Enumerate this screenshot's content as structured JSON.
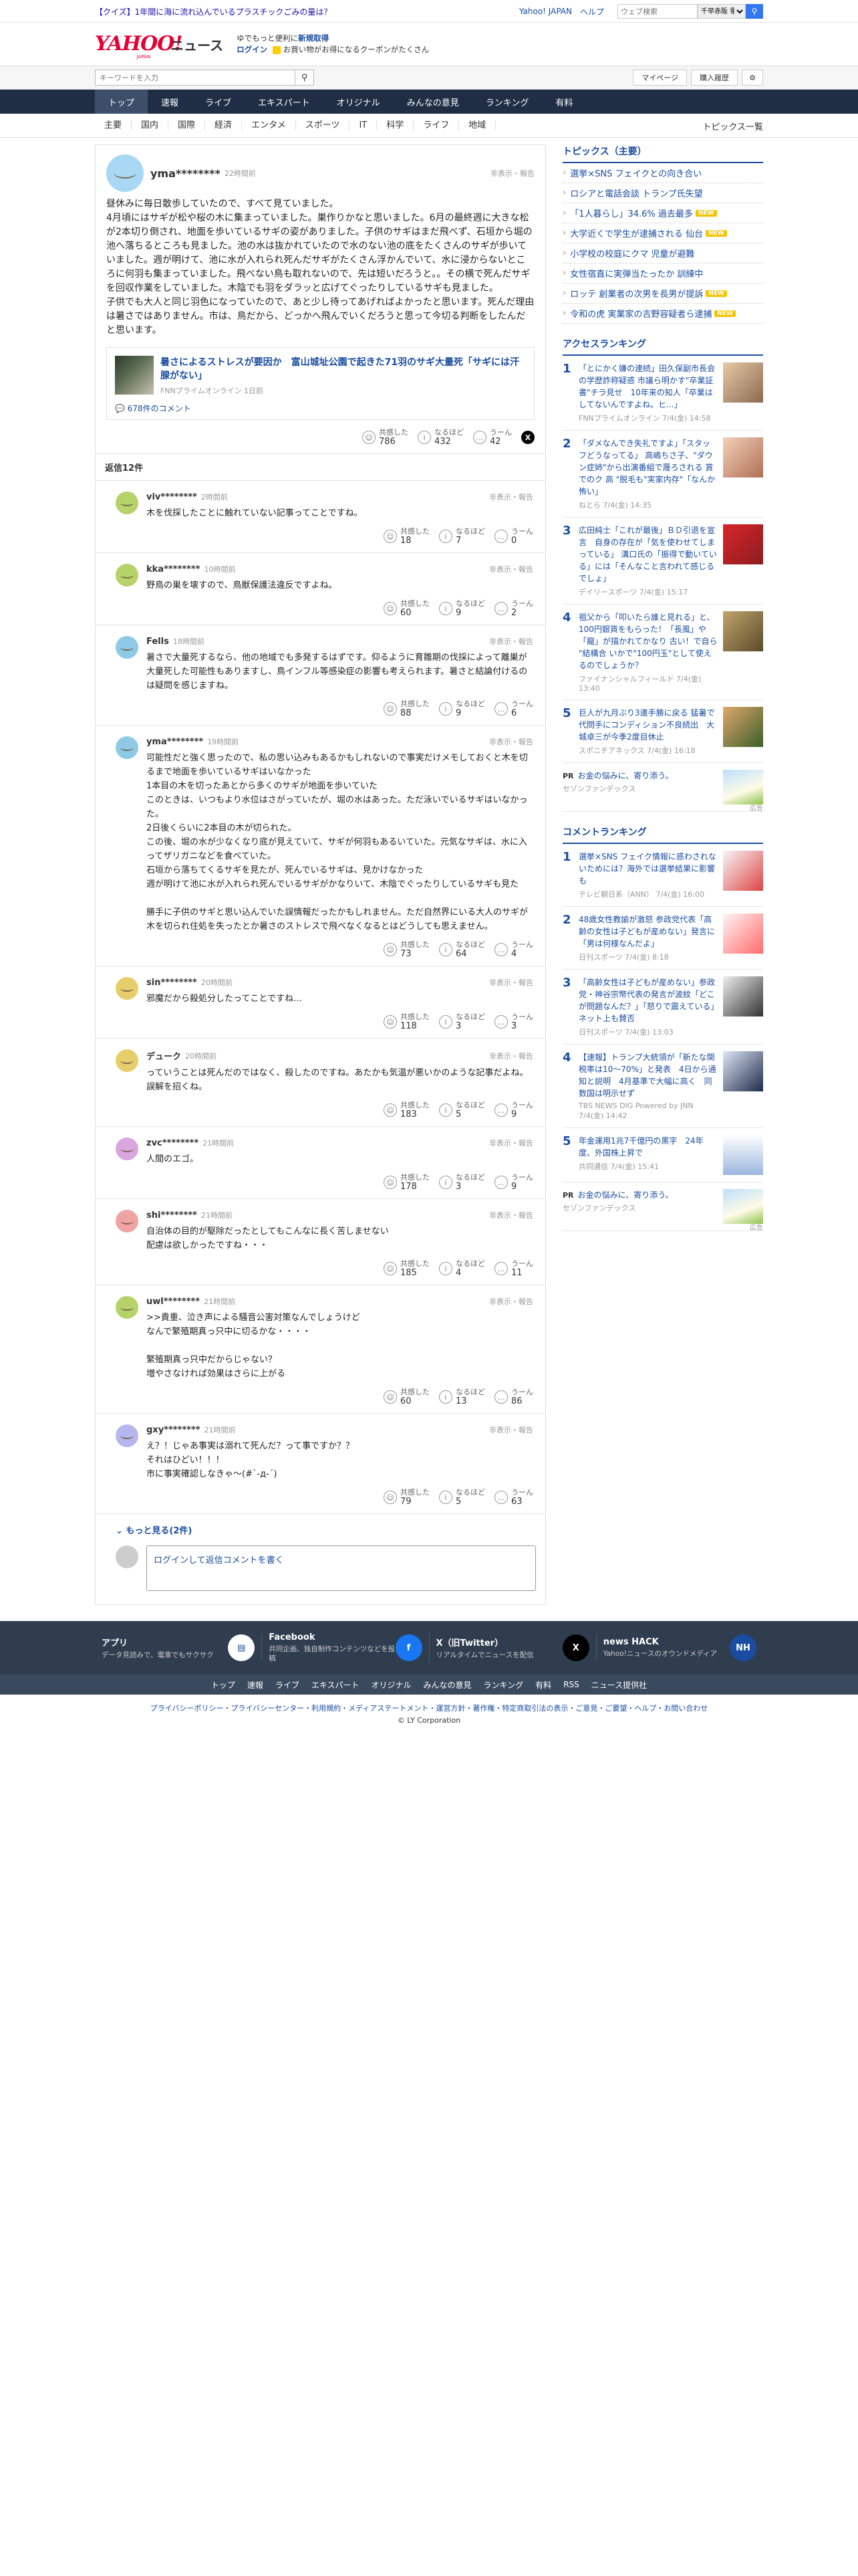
{
  "topbar": {
    "quiz": "【クイズ】1年間に海に流れ込んでいるプラスチックごみの量は？",
    "links": [
      "Yahoo! JAPAN",
      "ヘルプ"
    ],
    "search_placeholder": "ウェブ検索",
    "search_select": "千早赤阪 電も拳..."
  },
  "header": {
    "logo": "YAHOO!",
    "logo_sub": "JAPAN",
    "service": "ニュース",
    "promo_line1_a": "ゆでもっと便利に",
    "promo_line1_b": "新規取得",
    "login": "ログイン",
    "promo_line2": "お買い物がお得になるクーポンがたくさん"
  },
  "search": {
    "placeholder": "キーワードを入力",
    "mypage": "マイページ",
    "history": "購入履歴"
  },
  "gnav": [
    "トップ",
    "速報",
    "ライブ",
    "エキスパート",
    "オリジナル",
    "みんなの意見",
    "ランキング",
    "有料"
  ],
  "subnav": [
    "主要",
    "国内",
    "国際",
    "経済",
    "エンタメ",
    "スポーツ",
    "IT",
    "科学",
    "ライフ",
    "地域"
  ],
  "subnav_all": "トピックス一覧",
  "post": {
    "user": "yma********",
    "time": "22時間前",
    "report": "非表示・報告",
    "text": "昼休みに毎日散歩していたので、すべて見ていました。\n4月頃にはサギが松や桜の木に集まっていました。巣作りかなと思いました。6月の最終週に大きな松が2本切り倒され、地面を歩いているサギの姿がありました。子供のサギはまだ飛べず、石垣から堀の池へ落ちるところも見ました。池の水は抜かれていたので水のない池の底をたくさんのサギが歩いていました。週が明けて、池に水が入れられ死んだサギがたくさん浮かんでいて、水に浸からないところに何羽も集まっていました。飛べない鳥も取れないので、先は短いだろうと。。その横で死んだサギを回収作業をしていました。木陰でも羽をダラッと広げてぐったりしているサギも見ました。\n子供でも大人と同じ羽色になっていたので、あと少し待ってあげればよかったと思います。死んだ理由は暑さではありません。市は、鳥だから、どっかへ飛んでいくだろうと思って今切る判断をしたんだと思います。",
    "article_title": "暑さによるストレスが要因か　富山城址公園で起きた71羽のサギ大量死「サギには汗腺がない」",
    "article_source": "FNNプライムオンライン 1日前",
    "comments_count": "678件のコメント",
    "reactions": {
      "kyokan": "786",
      "naruhodo": "432",
      "uun": "42"
    }
  },
  "reaction_labels": {
    "kyokan": "共感した",
    "naruhodo": "なるほど",
    "uun": "うーん"
  },
  "replies_count_label": "返信12件",
  "replies": [
    {
      "user": "viv********",
      "time": "2時間前",
      "text": "木を伐採したことに触れていない記事ってことですね。",
      "kyokan": "18",
      "naruhodo": "7",
      "uun": "0",
      "color": "#b6d36a"
    },
    {
      "user": "kka********",
      "time": "10時間前",
      "text": "野鳥の巣を壊すので、鳥獣保護法違反ですよね。",
      "kyokan": "60",
      "naruhodo": "9",
      "uun": "2",
      "color": "#b6d36a"
    },
    {
      "user": "Fells",
      "time": "18時間前",
      "text": "暑さで大量死するなら、他の地域でも多発するはずです。仰るように育雛期の伐採によって離巣が大量死した可能性もありますし、鳥インフル等感染症の影響も考えられます。暑さと結論付けるのは疑問を感じますね。",
      "kyokan": "88",
      "naruhodo": "9",
      "uun": "6",
      "color": "#8ecae6"
    },
    {
      "user": "yma********",
      "time": "19時間前",
      "text": "可能性だと強く思ったので、私の思い込みもあるかもしれないので事実だけメモしておくと木を切るまで地面を歩いているサギはいなかった\n1本目の木を切ったあとから多くのサギが地面を歩いていた\nこのときは、いつもより水位はさがっていたが、堀の水はあった。ただ泳いでいるサギはいなかった。\n2日後くらいに2本目の木が切られた。\nこの後、堀の水が少なくなり底が見えていて、サギが何羽もあるいていた。元気なサギは、水に入ってザリガニなどを食べていた。\n石垣から落ちてくるサギを見たが、死んでいるサギは、見かけなかった\n週が明けて池に水が入れられ死んでいるサギがかなりいて、木陰でぐったりしているサギも見た\n\n勝手に子供のサギと思い込んでいた誤情報だったかもしれません。ただ自然界にいる大人のサギが木を切られ住処を失ったとか暑さのストレスで飛べなくなるとはどうしても思えません。",
      "kyokan": "73",
      "naruhodo": "64",
      "uun": "4",
      "color": "#8ecae6"
    },
    {
      "user": "sin********",
      "time": "20時間前",
      "text": "邪魔だから殺処分したってことですね…",
      "kyokan": "118",
      "naruhodo": "3",
      "uun": "3",
      "color": "#e6cf6b"
    },
    {
      "user": "デューク",
      "time": "20時間前",
      "text": "っていうことは死んだのではなく、殺したのですね。あたかも気温が悪いかのような記事だよね。誤解を招くね。",
      "kyokan": "183",
      "naruhodo": "5",
      "uun": "9",
      "color": "#e6cf6b"
    },
    {
      "user": "zvc********",
      "time": "21時間前",
      "text": "人間のエゴ。",
      "kyokan": "178",
      "naruhodo": "3",
      "uun": "9",
      "color": "#d9a6e0"
    },
    {
      "user": "shi********",
      "time": "21時間前",
      "text": "自治体の目的が駆除だったとしてもこんなに長く苦しませない\n配慮は欲しかったですね・・・",
      "kyokan": "185",
      "naruhodo": "4",
      "uun": "11",
      "color": "#f0a3a3"
    },
    {
      "user": "uwl********",
      "time": "21時間前",
      "text": ">>貴重、泣き声による騒音公害対策なんでしょうけど\nなんで繁殖期真っ只中に切るかな・・・・\n\n繁殖期真っ只中だからじゃない？\n増やさなければ効果はさらに上がる",
      "kyokan": "60",
      "naruhodo": "13",
      "uun": "86",
      "color": "#b6d36a"
    },
    {
      "user": "gxy********",
      "time": "21時間前",
      "text": "え？！じゃあ事実は溺れて死んだ？って事ですか？？\nそれはひどい！！！\n市に事実確認しなきゃ〜(#`-д-´)",
      "kyokan": "79",
      "naruhodo": "5",
      "uun": "63",
      "color": "#b7b7ef"
    }
  ],
  "more_label": "もっと見る(2件)",
  "comment_placeholder": "ログインして返信コメントを書く",
  "topics": {
    "title": "トピックス（主要）",
    "items": [
      {
        "text": "選挙×SNS フェイクとの向き合い",
        "new": false
      },
      {
        "text": "ロシアと電話会談 トランプ氏失望",
        "new": false
      },
      {
        "text": "「1人暮らし」34.6% 過去最多",
        "new": true
      },
      {
        "text": "大学近くで学生が逮捕される 仙台",
        "new": true
      },
      {
        "text": "小学校の校庭にクマ 児童が避難",
        "new": false
      },
      {
        "text": "女性宿直に実弾当たったか 訓練中",
        "new": false
      },
      {
        "text": "ロッテ 創業者の次男を長男が提訴",
        "new": true
      },
      {
        "text": "令和の虎 実業家の吉野容疑者ら逮捕",
        "new": true
      }
    ],
    "new_label": "NEW"
  },
  "access_ranking": {
    "title": "アクセスランキング",
    "items": [
      {
        "rank": "1",
        "title": "「とにかく嫌の連続」田久保副市長会の学歴詐称疑惑 市議ら明かす\"卒業証書\"チラ見せ　10年来の知人「卒業はしてないんですよね。ヒ...」",
        "source": "FNNプライムオンライン 7/4(金) 14:58"
      },
      {
        "rank": "2",
        "title": "「ダメなんでき失礼ですよ」「スタッフどうなってる」 高嶋ちさ子、\"ダウン症姉\"から出演番組で蔑ろされる 賞でのク 高 \"脱毛も\"実家内存\"「なんか怖い」",
        "source": "ねとら 7/4(金) 14:35"
      },
      {
        "rank": "3",
        "title": "広田純士「これが最後」ＢＤ引退を宣言　自身の存在が「気を使わせてしまっている」 溝口氏の「振得で動いている」には「そんなこと言われて感じるでしょ」",
        "source": "デイリースポーツ 7/4(金) 15:17"
      },
      {
        "rank": "4",
        "title": "祖父から「叩いたら誰と見れる」と、100円銀貨をもらった！「長風」や「龍」が描かれてかなり 古い！で自ら \"結構合 いかで\"100円玉\"として使えるのでしょうか？",
        "source": "ファイナンシャルフィールド 7/4(金) 13:40"
      },
      {
        "rank": "5",
        "title": "巨人が九月ぶり3連手勝に戻る 猛暑で代問手にコンディション不良続出　大城卓三が今季2度目休止",
        "source": "スポニチアネックス 7/4(金) 16:18"
      }
    ],
    "pr": {
      "tag": "PR",
      "title": "お金の悩みに、寄り添う。",
      "source": "セゾンファンデックス",
      "ad": "広告"
    }
  },
  "comment_ranking": {
    "title": "コメントランキング",
    "items": [
      {
        "rank": "1",
        "title": "選挙×SNS フェイク情報に惑わされないためには？海外では選挙結果に影響も",
        "source": "テレビ朝日系（ANN） 7/4(金) 16:00"
      },
      {
        "rank": "2",
        "title": "48歳女性教諭が激怒 参政党代表「高齢の女性は子どもが産めない」発言に「男は何様なんだよ」",
        "source": "日刊スポーツ 7/4(金) 8:18"
      },
      {
        "rank": "3",
        "title": "「高齢女性は子どもが産めない」参政党・神谷宗幣代表の発言が波紋「どこが問題なんだ？」「怒りで震えている」ネット上も賛否",
        "source": "日刊スポーツ 7/4(金) 13:03"
      },
      {
        "rank": "4",
        "title": "【速報】トランプ大統領が「新たな関税率は10〜70%」と発表　4日から通知と説明　4月基準で大幅に高く　同数国は明示せず",
        "source": "TBS NEWS DIG Powered by JNN 7/4(金) 14:42"
      },
      {
        "rank": "5",
        "title": "年金運用1兆7千億円の黒字　24年度、外国株上昇で",
        "source": "共同通信 7/4(金) 15:41"
      }
    ],
    "pr": {
      "tag": "PR",
      "title": "お金の悩みに、寄り添う。",
      "source": "セゾンファンデックス",
      "ad": "広告"
    }
  },
  "footer": {
    "blocks": [
      {
        "title": "アプリ",
        "desc": "データ見読みで、電車でもサクサク",
        "icon": "news-app-icon"
      },
      {
        "title": "Facebook",
        "desc": "共同企画、独自制作コンテンツなどを投稿",
        "icon": "facebook-icon"
      },
      {
        "title": "X（旧Twitter）",
        "desc": "リアルタイムでニュースを配信",
        "icon": "x-icon"
      },
      {
        "title": "news HACK",
        "desc": "Yahoo!ニュースのオウンドメディア",
        "icon": "newshack-icon"
      }
    ],
    "nav": [
      "トップ",
      "速報",
      "ライブ",
      "エキスパート",
      "オリジナル",
      "みんなの意見",
      "ランキング",
      "有料",
      "RSS",
      "ニュース提供社"
    ],
    "legal": "プライバシーポリシー・プライバシーセンター・利用規約・メディアステートメント・運営方針・著作権・特定商取引法の表示・ご意見・ご要望・ヘルプ・お問い合わせ",
    "copyright": "© LY Corporation"
  }
}
